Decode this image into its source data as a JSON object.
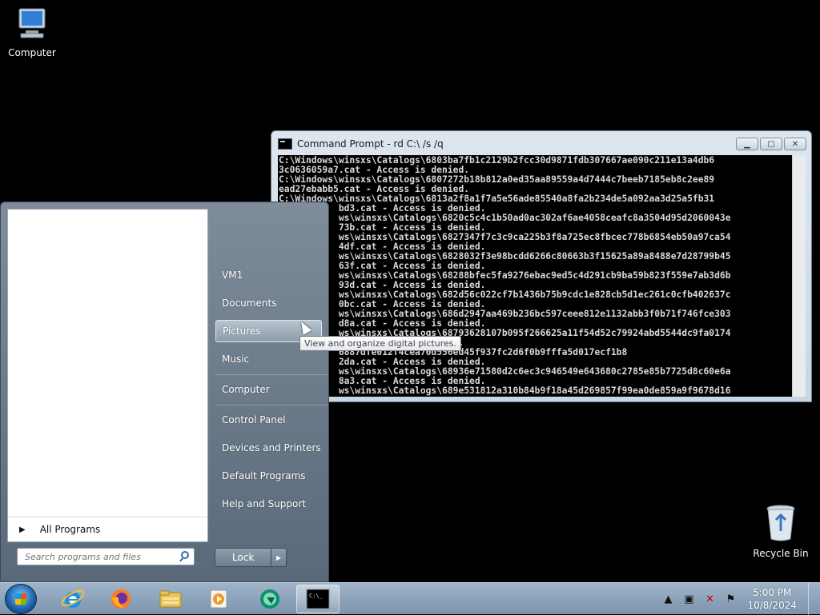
{
  "desktop": {
    "icons": [
      {
        "label": "Computer",
        "icon": "computer-icon"
      },
      {
        "label": "Recycle Bin",
        "icon": "recycle-bin-icon"
      }
    ]
  },
  "cmd": {
    "title": "Command Prompt - rd  C:\\ /s /q",
    "lines": [
      "C:\\Windows\\winsxs\\Catalogs\\6803ba7fb1c2129b2fcc30d9871fdb307667ae090c211e13a4db6",
      "3c0636059a7.cat - Access is denied.",
      "C:\\Windows\\winsxs\\Catalogs\\6807272b18b812a0ed35aa89559a4d7444c7beeb7185eb8c2ee89",
      "ead27ebabb5.cat - Access is denied.",
      "C:\\Windows\\winsxs\\Catalogs\\6813a2f8a1f7a5e56ade85540a8fa2b234de5a092aa3d25a5fb31",
      "           bd3.cat - Access is denied.",
      "           ws\\winsxs\\Catalogs\\6820c5c4c1b50ad0ac302af6ae4058ceafc8a3504d95d2060043e",
      "           73b.cat - Access is denied.",
      "           ws\\winsxs\\Catalogs\\6827347f7c3c9ca225b3f8a725ec8fbcec778b6854eb50a97ca54",
      "           4df.cat - Access is denied.",
      "           ws\\winsxs\\Catalogs\\6828032f3e98bcdd6266c80663b3f15625a89a8488e7d28799b45",
      "           63f.cat - Access is denied.",
      "           ws\\winsxs\\Catalogs\\68288bfec5fa9276ebac9ed5c4d291cb9ba59b823f559e7ab3d6b",
      "           93d.cat - Access is denied.",
      "           ws\\winsxs\\Catalogs\\682d56c022cf7b1436b75b9cdc1e828cb5d1ec261c0cfb402637c",
      "           0bc.cat - Access is denied.",
      "           ws\\winsxs\\Catalogs\\686d2947aa469b236bc597ceee812e1132abb3f0b71f746fce303",
      "           d8a.cat - Access is denied.",
      "           ws\\winsxs\\Catalogs\\68793628107b095f266625a11f54d52c79924abd5544dc9fa0174",
      "           cat - Access is denied.",
      "           6887dfe012f4cea70d556ed45f937fc2d6f0b9fffa5d017ecf1b8",
      "           2da.cat - Access is denied.",
      "           ws\\winsxs\\Catalogs\\68936e71580d2c6ec3c946549e643680c2785e85b7725d8c60e6a",
      "           8a3.cat - Access is denied.",
      "           ws\\winsxs\\Catalogs\\689e531812a310b84b9f18a45d269857f99ea0de859a9f9678d16"
    ]
  },
  "start_menu": {
    "right_items": [
      {
        "label": "VM1",
        "name": "sm-item-vm1"
      },
      {
        "label": "Documents",
        "name": "sm-item-documents"
      },
      {
        "label": "Pictures",
        "name": "sm-item-pictures"
      },
      {
        "label": "Music",
        "name": "sm-item-music"
      },
      {
        "label": "Computer",
        "name": "sm-item-computer"
      },
      {
        "label": "Control Panel",
        "name": "sm-item-control-panel"
      },
      {
        "label": "Devices and Printers",
        "name": "sm-item-devices-printers"
      },
      {
        "label": "Default Programs",
        "name": "sm-item-default-programs"
      },
      {
        "label": "Help and Support",
        "name": "sm-item-help-support"
      }
    ],
    "all_programs": "All Programs",
    "search_placeholder": "Search programs and files",
    "lock_label": "Lock",
    "tooltip": "View and organize digital pictures."
  },
  "taskbar": {
    "apps": [
      "internet-explorer-icon",
      "firefox-icon",
      "file-explorer-icon",
      "media-player-icon",
      "app-icon",
      "command-prompt-icon"
    ],
    "clock_time": "5:00 PM",
    "clock_date": "10/8/2024"
  }
}
